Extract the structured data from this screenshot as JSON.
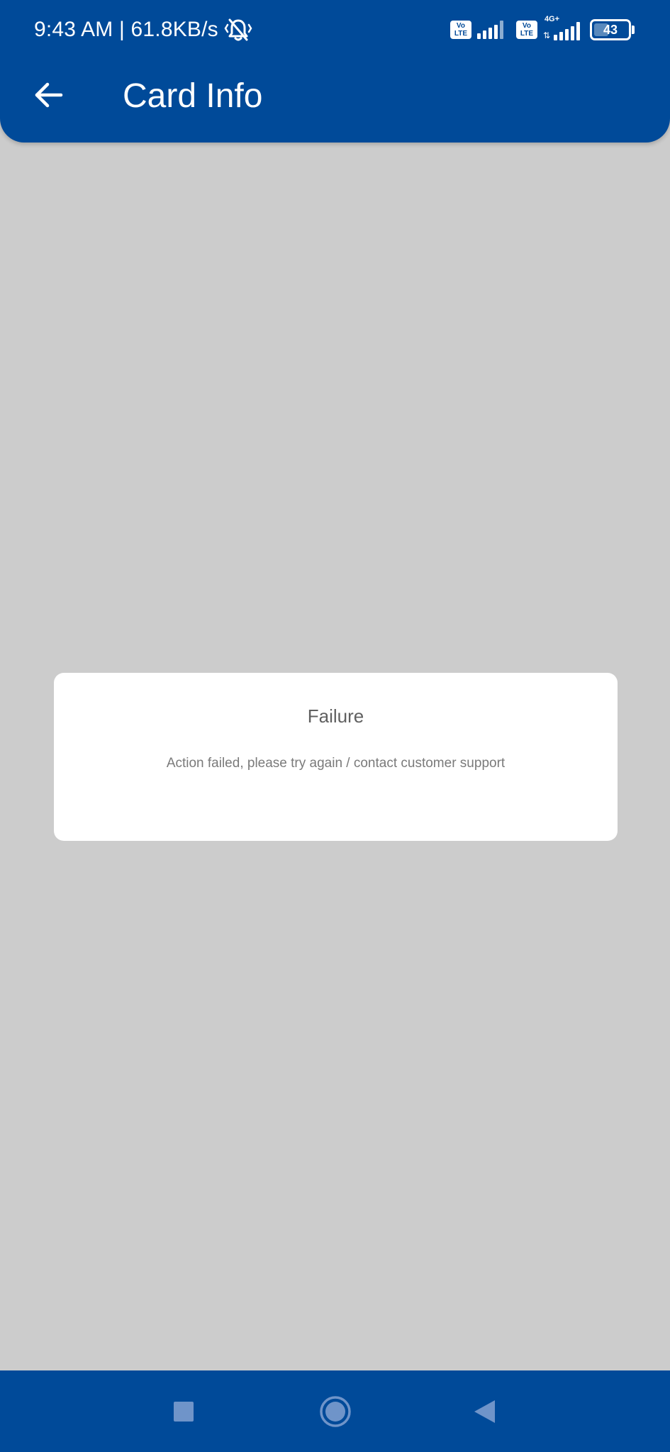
{
  "colors": {
    "primary": "#004a99",
    "scrim_background": "#cccccc",
    "dialog_background": "#ffffff",
    "nav_icon": "#6f94c9"
  },
  "status_bar": {
    "time_speed": "9:43 AM | 61.8KB/s",
    "mute_icon": "bell-muted-icon",
    "volte_label": "Vo\nLTE",
    "network_type": "4G+",
    "battery_level": "43"
  },
  "toolbar": {
    "back_icon": "arrow-left-icon",
    "title": "Card Info"
  },
  "dialog": {
    "title": "Failure",
    "message": "Action failed, please try again / contact customer support"
  },
  "nav_bar": {
    "recents_icon": "square-icon",
    "home_icon": "circle-icon",
    "back_icon": "triangle-back-icon"
  }
}
